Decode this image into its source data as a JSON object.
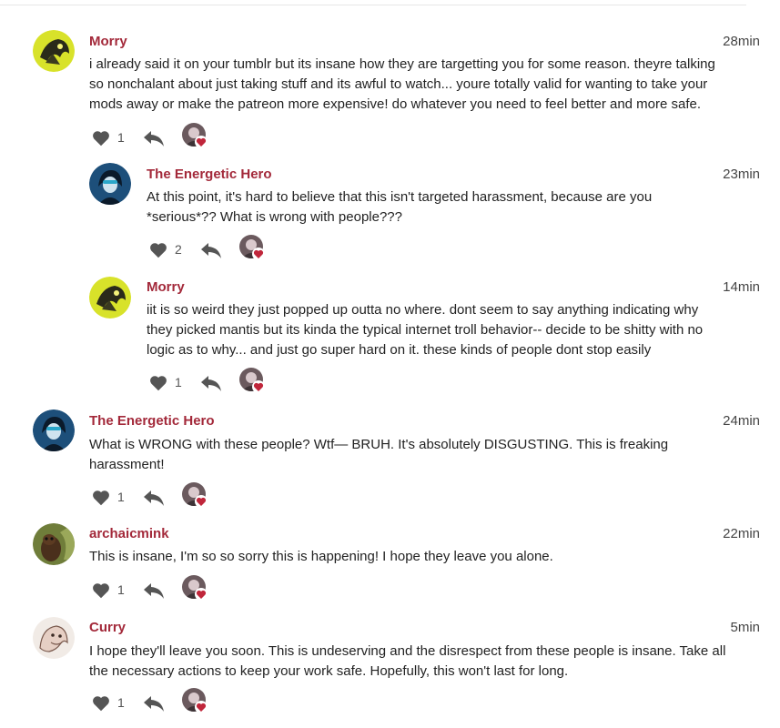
{
  "comments": [
    {
      "author": "Morry",
      "time": "28min",
      "text_lines": [
        "i already said it on your tumblr but its insane how they are targetting you for some reason. theyre talking",
        "so nonchalant about just taking stuff and its awful to watch... youre totally valid for wanting to take your",
        "mods away or make the patreon more expensive! do whatever you need to feel better and more safe."
      ],
      "likes": "1",
      "avatar_icon": "yellow-character-avatar"
    },
    {
      "author": "The Energetic Hero",
      "time": "23min",
      "text_lines": [
        "At this point, it's hard to believe that this isn't targeted harassment, because are you",
        "*serious*?? What is wrong with people???"
      ],
      "likes": "2",
      "avatar_icon": "blue-hero-avatar"
    },
    {
      "author": "Morry",
      "time": "14min",
      "text_lines": [
        "iit is so weird they just popped up outta no where. dont seem to say anything indicating why",
        "they picked mantis but its kinda the typical internet troll behavior-- decide to be shitty with no",
        "logic as to why... and just go super hard on it. these kinds of people dont stop easily"
      ],
      "likes": "1",
      "avatar_icon": "yellow-character-avatar"
    },
    {
      "author": "The Energetic Hero",
      "time": "24min",
      "text_lines": [
        "What is WRONG with these people? Wtf— BRUH. It's absolutely DISGUSTING. This is freaking",
        "harassment!"
      ],
      "likes": "1",
      "avatar_icon": "blue-hero-avatar"
    },
    {
      "author": "archaicmink",
      "time": "22min",
      "text_lines": [
        "This is insane, I'm so so sorry this is happening! I hope they leave you alone."
      ],
      "likes": "1",
      "avatar_icon": "mink-photo-avatar"
    },
    {
      "author": "Curry",
      "time": "5min",
      "text_lines": [
        "I hope they'll leave you soon. This is undeserving and the disrespect from these people is insane. Take all",
        "the necessary actions to keep your work safe. Hopefully, this won't last for long."
      ],
      "likes": "1",
      "avatar_icon": "sketch-animal-avatar"
    }
  ],
  "icons": {
    "like": "heart-icon",
    "reply": "reply-arrow-icon",
    "creator": "creator-liked-avatar-icon"
  },
  "colors": {
    "author": "#a3293a",
    "icon": "#555555",
    "heart_badge": "#c0263b"
  }
}
